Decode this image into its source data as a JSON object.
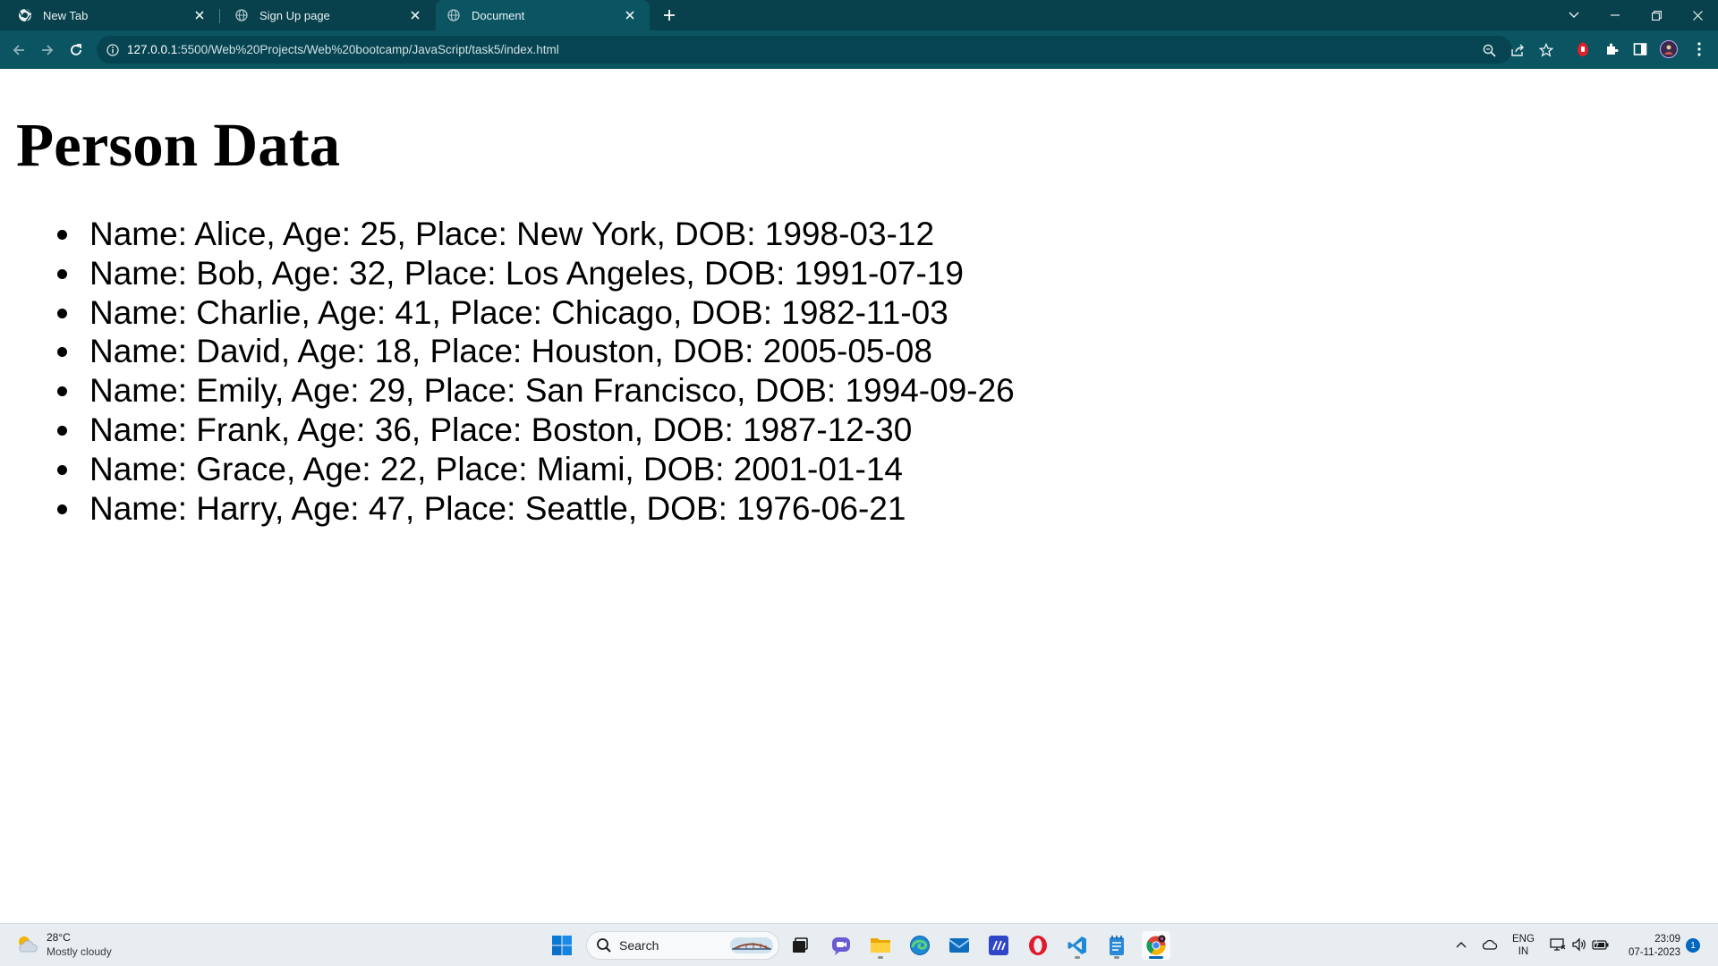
{
  "browser": {
    "tabs": [
      {
        "title": "New Tab",
        "icon": "chrome-icon",
        "active": false
      },
      {
        "title": "Sign Up page",
        "icon": "globe-icon",
        "active": false
      },
      {
        "title": "Document",
        "icon": "globe-icon",
        "active": true
      }
    ],
    "url_host": "127.0.0.1",
    "url_path": ":5500/Web%20Projects/Web%20bootcamp/JavaScript/task5/index.html",
    "colors": {
      "chrome": "#0b5563",
      "tabstrip": "#08404b",
      "omnibox": "#064451"
    }
  },
  "page": {
    "title": "Person Data",
    "people": [
      "Name: Alice, Age: 25, Place: New York, DOB: 1998-03-12",
      "Name: Bob, Age: 32, Place: Los Angeles, DOB: 1991-07-19",
      "Name: Charlie, Age: 41, Place: Chicago, DOB: 1982-11-03",
      "Name: David, Age: 18, Place: Houston, DOB: 2005-05-08",
      "Name: Emily, Age: 29, Place: San Francisco, DOB: 1994-09-26",
      "Name: Frank, Age: 36, Place: Boston, DOB: 1987-12-30",
      "Name: Grace, Age: 22, Place: Miami, DOB: 2001-01-14",
      "Name: Harry, Age: 47, Place: Seattle, DOB: 1976-06-21"
    ]
  },
  "taskbar": {
    "weather_temp": "28°C",
    "weather_desc": "Mostly cloudy",
    "search_label": "Search",
    "lang_line1": "ENG",
    "lang_line2": "IN",
    "time": "23:09",
    "date": "07-11-2023",
    "notification_count": "1",
    "apps": [
      "windows-start-icon",
      "search-box",
      "task-view-icon",
      "teams-chat-icon",
      "file-explorer-icon",
      "edge-icon",
      "mail-icon",
      "editor-app-icon",
      "opera-icon",
      "vscode-icon",
      "notepad-icon",
      "chrome-icon"
    ]
  }
}
